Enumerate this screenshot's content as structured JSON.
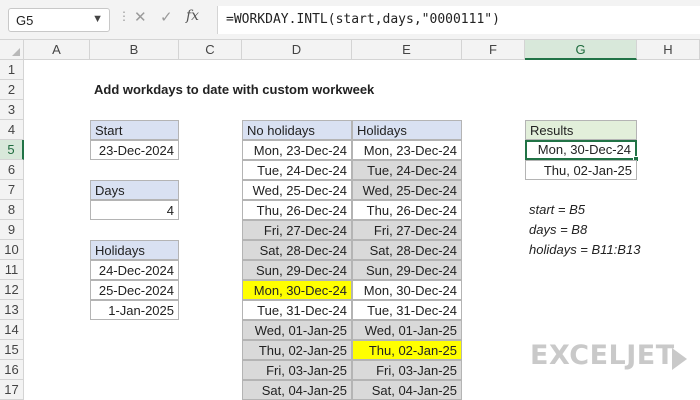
{
  "formula_bar": {
    "name_box": "G5",
    "formula": "=WORKDAY.INTL(start,days,\"0000111\")",
    "icons": [
      "chevron-down-icon",
      "cancel-x-icon",
      "check-icon",
      "fx-icon"
    ]
  },
  "columns": [
    "A",
    "B",
    "C",
    "D",
    "E",
    "F",
    "G",
    "H"
  ],
  "rows": [
    "1",
    "2",
    "3",
    "4",
    "5",
    "6",
    "7",
    "8",
    "9",
    "10",
    "11",
    "12",
    "13",
    "14",
    "15",
    "16",
    "17"
  ],
  "selected_column": "G",
  "selected_row": "5",
  "title": "Add workdays to date with custom workweek",
  "start": {
    "label": "Start",
    "value": "23-Dec-2024"
  },
  "days": {
    "label": "Days",
    "value": "4"
  },
  "holidays_input": {
    "label": "Holidays",
    "values": [
      "24-Dec-2024",
      "25-Dec-2024",
      "1-Jan-2025"
    ]
  },
  "table": {
    "header_no_holidays": "No holidays",
    "header_holidays": "Holidays",
    "no_holidays": [
      "Mon, 23-Dec-24",
      "Tue, 24-Dec-24",
      "Wed, 25-Dec-24",
      "Thu, 26-Dec-24",
      "Fri, 27-Dec-24",
      "Sat, 28-Dec-24",
      "Sun, 29-Dec-24",
      "Mon, 30-Dec-24",
      "Tue, 31-Dec-24",
      "Wed, 01-Jan-25",
      "Thu, 02-Jan-25",
      "Fri, 03-Jan-25",
      "Sat, 04-Jan-25"
    ],
    "holidays": [
      "Mon, 23-Dec-24",
      "Tue, 24-Dec-24",
      "Wed, 25-Dec-24",
      "Thu, 26-Dec-24",
      "Fri, 27-Dec-24",
      "Sat, 28-Dec-24",
      "Sun, 29-Dec-24",
      "Mon, 30-Dec-24",
      "Tue, 31-Dec-24",
      "Wed, 01-Jan-25",
      "Thu, 02-Jan-25",
      "Fri, 03-Jan-25",
      "Sat, 04-Jan-25"
    ]
  },
  "results": {
    "label": "Results",
    "values": [
      "Mon, 30-Dec-24",
      "Thu, 02-Jan-25"
    ]
  },
  "notes": [
    "start = B5",
    "days = B8",
    "holidays = B11:B13"
  ],
  "logo": "EXCELJET",
  "colors": {
    "accent_green": "#217346",
    "header_blue": "#d9e1f2",
    "header_green": "#e2efda",
    "shade_gray": "#d9d9d9",
    "highlight_yellow": "#ffff00"
  }
}
